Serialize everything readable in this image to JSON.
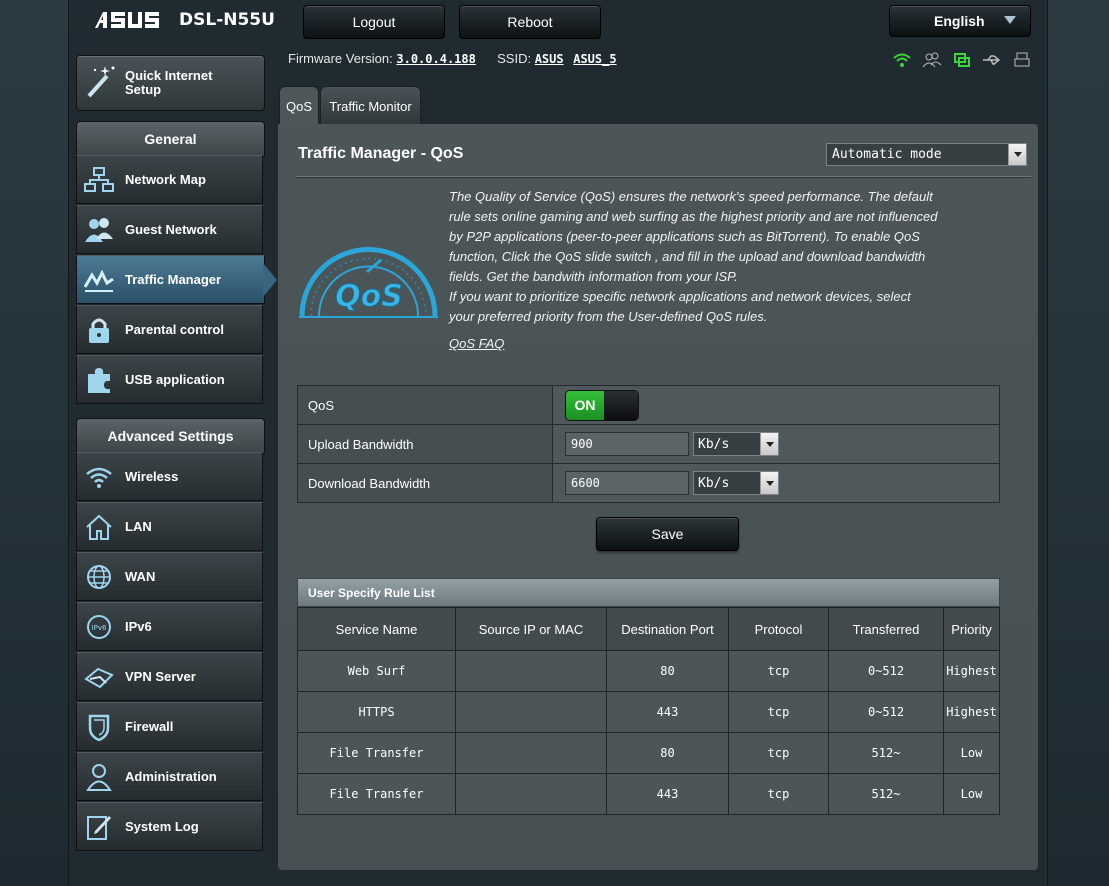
{
  "header": {
    "logo": "/ISUS",
    "model": "DSL-N55U",
    "logout_label": "Logout",
    "reboot_label": "Reboot",
    "language": "English"
  },
  "info": {
    "firmware_label": "Firmware Version:",
    "firmware_value": "3.0.0.4.188",
    "ssid_label": "SSID:",
    "ssid_1": "ASUS",
    "ssid_2": "ASUS_5"
  },
  "sidebar": {
    "qis_line1": "Quick Internet",
    "qis_line2": "Setup",
    "general_title": "General",
    "general": [
      {
        "label": "Network Map",
        "icon": "network-map-icon"
      },
      {
        "label": "Guest Network",
        "icon": "guest-network-icon"
      },
      {
        "label": "Traffic Manager",
        "icon": "traffic-manager-icon"
      },
      {
        "label": "Parental control",
        "icon": "lock-icon"
      },
      {
        "label": "USB application",
        "icon": "puzzle-icon"
      }
    ],
    "advanced_title": "Advanced Settings",
    "advanced": [
      {
        "label": "Wireless",
        "icon": "wifi-icon"
      },
      {
        "label": "LAN",
        "icon": "home-icon"
      },
      {
        "label": "WAN",
        "icon": "globe-icon"
      },
      {
        "label": "IPv6",
        "icon": "ipv6-icon"
      },
      {
        "label": "VPN Server",
        "icon": "vpn-icon"
      },
      {
        "label": "Firewall",
        "icon": "shield-icon"
      },
      {
        "label": "Administration",
        "icon": "user-admin-icon"
      },
      {
        "label": "System Log",
        "icon": "log-icon"
      }
    ]
  },
  "tabs": {
    "qos": "QoS",
    "monitor": "Traffic Monitor"
  },
  "main": {
    "title": "Traffic Manager - QoS",
    "mode": "Automatic mode",
    "description": [
      "The Quality of Service (QoS) ensures the network's speed performance. The default",
      "rule sets online gaming and web surfing as the highest priority and are not influenced",
      "by P2P applications (peer-to-peer applications such as BitTorrent). To enable QoS",
      "function, Click the QoS slide switch , and fill in the upload and download bandwidth",
      "fields. Get the bandwith information from your ISP.",
      "If you want to prioritize specific network applications and network devices, select",
      "your preferred priority from the User-defined QoS rules."
    ],
    "faq": "QoS FAQ",
    "qos_label": "QoS",
    "qos_state": "ON",
    "upload_label": "Upload Bandwidth",
    "upload_value": "900",
    "upload_unit": "Kb/s",
    "download_label": "Download Bandwidth",
    "download_value": "6600",
    "download_unit": "Kb/s",
    "save_label": "Save"
  },
  "rules": {
    "title": "User Specify Rule List",
    "columns": [
      "Service Name",
      "Source IP or MAC",
      "Destination Port",
      "Protocol",
      "Transferred",
      "Priority"
    ],
    "rows": [
      [
        "Web Surf",
        "",
        "80",
        "tcp",
        "0~512",
        "Highest"
      ],
      [
        "HTTPS",
        "",
        "443",
        "tcp",
        "0~512",
        "Highest"
      ],
      [
        "File Transfer",
        "",
        "80",
        "tcp",
        "512~",
        "Low"
      ],
      [
        "File Transfer",
        "",
        "443",
        "tcp",
        "512~",
        "Low"
      ]
    ]
  },
  "colors": {
    "accent": "#3a6580",
    "toggle_on": "#2aab2f",
    "status_green": "#3cd43c"
  }
}
